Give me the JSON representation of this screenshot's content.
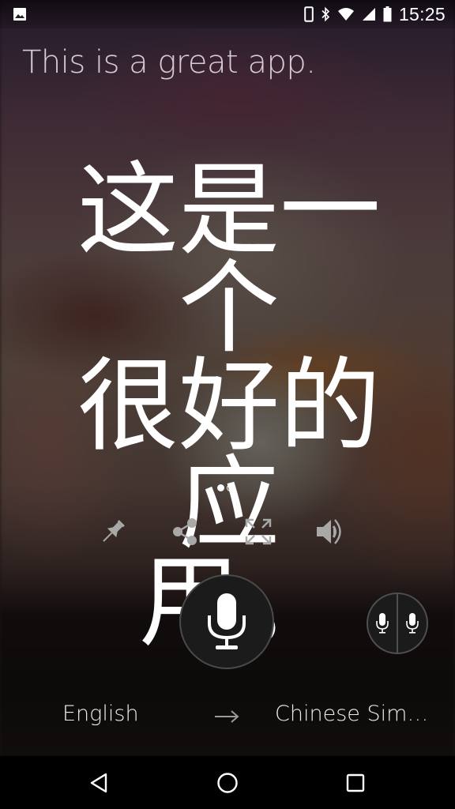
{
  "status_bar": {
    "notification_icon": "image-icon",
    "icons": [
      "phone-icon",
      "bluetooth-icon",
      "wifi-icon",
      "cell-signal-icon",
      "battery-icon"
    ],
    "time": "15:25"
  },
  "source": {
    "text": "This is a great app."
  },
  "translation": {
    "line1": "这是一个",
    "line2": "很好的应",
    "line3": "用。"
  },
  "pager": {
    "count": 2,
    "active_index": 0
  },
  "actions": [
    {
      "name": "pin",
      "icon": "pin-icon"
    },
    {
      "name": "share",
      "icon": "share-icon"
    },
    {
      "name": "fullscreen",
      "icon": "fullscreen-icon"
    },
    {
      "name": "speak",
      "icon": "volume-icon"
    }
  ],
  "mic": {
    "main_icon": "microphone-icon",
    "conversation_icon": "dual-microphone-icon"
  },
  "languages": {
    "source": "English",
    "arrow": "→",
    "target": "Chinese Simpli..."
  },
  "nav_bar": {
    "buttons": [
      "back",
      "home",
      "recents"
    ]
  },
  "colors": {
    "text_primary": "#ffffff",
    "icon_gray": "#a8a8a8",
    "mic_bg": "#1b1b1b",
    "mic_border": "#4a4a4a",
    "nav_bg": "#000000"
  }
}
